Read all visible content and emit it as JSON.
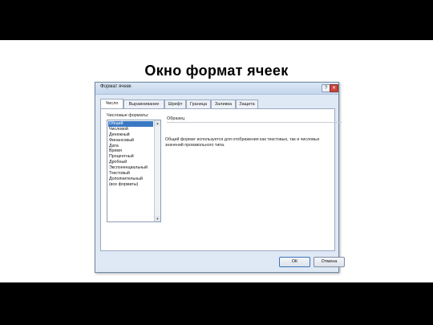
{
  "slide": {
    "title": "Окно формат ячеек"
  },
  "dialog": {
    "title": "Формат ячеек",
    "help_symbol": "?",
    "close_symbol": "✕",
    "tabs": [
      "Число",
      "Выравнивание",
      "Шрифт",
      "Граница",
      "Заливка",
      "Защита"
    ],
    "active_tab": "Число",
    "formats_label": "Числовые форматы:",
    "formats": [
      "Общий",
      "Числовой",
      "Денежный",
      "Финансовый",
      "Дата",
      "Время",
      "Процентный",
      "Дробный",
      "Экспоненциальный",
      "Текстовый",
      "Дополнительный",
      "(все форматы)"
    ],
    "selected_format": "Общий",
    "sample_label": "Образец",
    "description": "Общий формат используется для отображения как текстовых, так и числовых значений произвольного типа.",
    "ok_label": "ОК",
    "cancel_label": "Отмена"
  },
  "navigation": {
    "icons": [
      "prev-arrow-icon",
      "next-arrow-icon",
      "home-icon",
      "exit-arrow-icon"
    ],
    "color": "#2e7d3b"
  }
}
